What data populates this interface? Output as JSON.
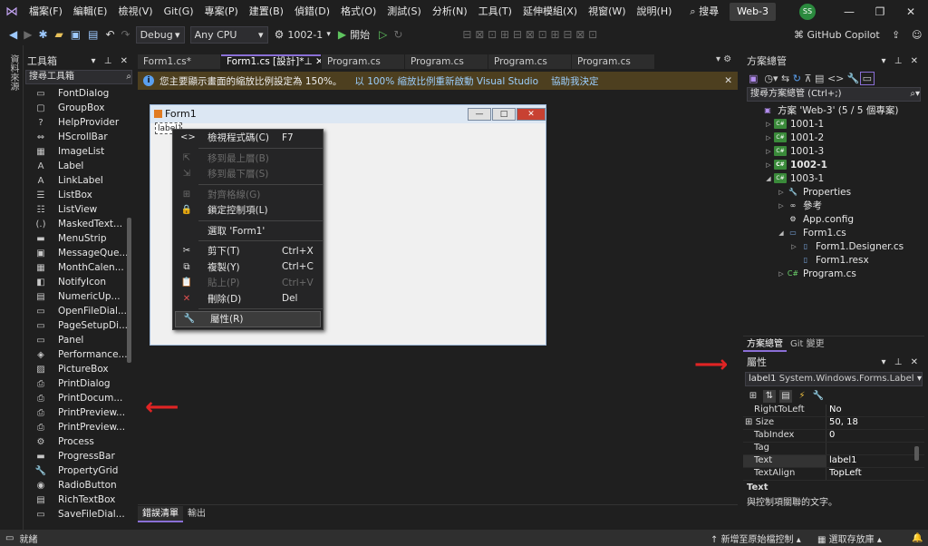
{
  "menubar": {
    "items": [
      "檔案(F)",
      "編輯(E)",
      "檢視(V)",
      "Git(G)",
      "專案(P)",
      "建置(B)",
      "偵錯(D)",
      "格式(O)",
      "測試(S)",
      "分析(N)",
      "工具(T)",
      "延伸模組(X)",
      "視窗(W)",
      "說明(H)"
    ],
    "search": "搜尋",
    "solution_name": "Web-3",
    "avatar": "SS"
  },
  "toolbar": {
    "config": "Debug",
    "platform": "Any CPU",
    "startup_project": "1002-1",
    "start_label": "開始",
    "copilot": "GitHub Copilot"
  },
  "left_strip": {
    "label": "資料來源"
  },
  "toolbox": {
    "title": "工具箱",
    "search_placeholder": "搜尋工具箱",
    "items": [
      {
        "icon": "▭",
        "label": "FontDialog"
      },
      {
        "icon": "▢",
        "label": "GroupBox"
      },
      {
        "icon": "?",
        "label": "HelpProvider"
      },
      {
        "icon": "⇔",
        "label": "HScrollBar"
      },
      {
        "icon": "▦",
        "label": "ImageList"
      },
      {
        "icon": "A",
        "label": "Label"
      },
      {
        "icon": "A",
        "label": "LinkLabel"
      },
      {
        "icon": "☰",
        "label": "ListBox"
      },
      {
        "icon": "☷",
        "label": "ListView"
      },
      {
        "icon": "(.)",
        "label": "MaskedText..."
      },
      {
        "icon": "▬",
        "label": "MenuStrip"
      },
      {
        "icon": "▣",
        "label": "MessageQue..."
      },
      {
        "icon": "▦",
        "label": "MonthCalen..."
      },
      {
        "icon": "◧",
        "label": "NotifyIcon"
      },
      {
        "icon": "▤",
        "label": "NumericUp..."
      },
      {
        "icon": "▭",
        "label": "OpenFileDial..."
      },
      {
        "icon": "▭",
        "label": "PageSetupDi..."
      },
      {
        "icon": "▭",
        "label": "Panel"
      },
      {
        "icon": "◈",
        "label": "Performance..."
      },
      {
        "icon": "▨",
        "label": "PictureBox"
      },
      {
        "icon": "⎙",
        "label": "PrintDialog"
      },
      {
        "icon": "⎙",
        "label": "PrintDocum..."
      },
      {
        "icon": "⎙",
        "label": "PrintPreview..."
      },
      {
        "icon": "⎙",
        "label": "PrintPreview..."
      },
      {
        "icon": "⚙",
        "label": "Process"
      },
      {
        "icon": "▬",
        "label": "ProgressBar"
      },
      {
        "icon": "🔧",
        "label": "PropertyGrid"
      },
      {
        "icon": "◉",
        "label": "RadioButton"
      },
      {
        "icon": "▤",
        "label": "RichTextBox"
      },
      {
        "icon": "▭",
        "label": "SaveFileDial..."
      }
    ]
  },
  "tabs": [
    {
      "label": "Form1.cs*",
      "active": false
    },
    {
      "label": "Form1.cs [設計]*",
      "active": true
    },
    {
      "label": "Program.cs",
      "active": false
    },
    {
      "label": "Program.cs",
      "active": false
    },
    {
      "label": "Program.cs",
      "active": false
    },
    {
      "label": "Program.cs",
      "active": false
    }
  ],
  "infobar": {
    "message": "您主要顯示畫面的縮放比例設定為 150%。",
    "link1": "以 100% 縮放比例重新啟動 Visual Studio",
    "link2": "協助我決定"
  },
  "form": {
    "title": "Form1",
    "label": "label1"
  },
  "context_menu": [
    {
      "icon": "<>",
      "label": "檢視程式碼(C)",
      "shortcut": "F7",
      "disabled": false
    },
    {
      "sep": true
    },
    {
      "icon": "⇱",
      "label": "移到最上層(B)",
      "shortcut": "",
      "disabled": true
    },
    {
      "icon": "⇲",
      "label": "移到最下層(S)",
      "shortcut": "",
      "disabled": true
    },
    {
      "sep": true
    },
    {
      "icon": "⊞",
      "label": "對齊格線(G)",
      "shortcut": "",
      "disabled": true
    },
    {
      "icon": "🔒",
      "label": "鎖定控制項(L)",
      "shortcut": "",
      "disabled": false
    },
    {
      "sep": true
    },
    {
      "icon": "",
      "label": "選取 'Form1'",
      "shortcut": "",
      "disabled": false
    },
    {
      "sep": true
    },
    {
      "icon": "✂",
      "label": "剪下(T)",
      "shortcut": "Ctrl+X",
      "disabled": false
    },
    {
      "icon": "⧉",
      "label": "複製(Y)",
      "shortcut": "Ctrl+C",
      "disabled": false
    },
    {
      "icon": "📋",
      "label": "貼上(P)",
      "shortcut": "Ctrl+V",
      "disabled": true
    },
    {
      "icon": "✕",
      "label": "刪除(D)",
      "shortcut": "Del",
      "disabled": false
    },
    {
      "sep": true
    },
    {
      "icon": "🔧",
      "label": "屬性(R)",
      "shortcut": "",
      "disabled": false,
      "selected": true
    }
  ],
  "bottom_tabs": [
    "錯誤清單",
    "輸出"
  ],
  "solution_explorer": {
    "title": "方案總管",
    "search_placeholder": "搜尋方案總管 (Ctrl+;)",
    "nodes": [
      {
        "depth": 0,
        "arrow": "",
        "icon": "sln",
        "label": "方案 'Web-3' (5 / 5 個專案)",
        "bold": false
      },
      {
        "depth": 1,
        "arrow": "▷",
        "icon": "cs",
        "label": "1001-1",
        "bold": false
      },
      {
        "depth": 1,
        "arrow": "▷",
        "icon": "cs",
        "label": "1001-2",
        "bold": false
      },
      {
        "depth": 1,
        "arrow": "▷",
        "icon": "cs",
        "label": "1001-3",
        "bold": false
      },
      {
        "depth": 1,
        "arrow": "▷",
        "icon": "cs",
        "label": "1002-1",
        "bold": true
      },
      {
        "depth": 1,
        "arrow": "◢",
        "icon": "cs",
        "label": "1003-1",
        "bold": false
      },
      {
        "depth": 2,
        "arrow": "▷",
        "icon": "wrench",
        "label": "Properties",
        "bold": false
      },
      {
        "depth": 2,
        "arrow": "▷",
        "icon": "ref",
        "label": "參考",
        "bold": false
      },
      {
        "depth": 2,
        "arrow": "",
        "icon": "config",
        "label": "App.config",
        "bold": false
      },
      {
        "depth": 2,
        "arrow": "◢",
        "icon": "form",
        "label": "Form1.cs",
        "bold": false
      },
      {
        "depth": 3,
        "arrow": "▷",
        "icon": "file",
        "label": "Form1.Designer.cs",
        "bold": false
      },
      {
        "depth": 3,
        "arrow": "",
        "icon": "file",
        "label": "Form1.resx",
        "bold": false
      },
      {
        "depth": 2,
        "arrow": "▷",
        "icon": "csfile",
        "label": "Program.cs",
        "bold": false
      }
    ],
    "footer_tabs": [
      "方案總管",
      "Git 變更"
    ]
  },
  "properties": {
    "title": "屬性",
    "object_name": "label1",
    "object_type": "System.Windows.Forms.Label",
    "rows": [
      {
        "name": "RightToLeft",
        "value": "No",
        "expand": false
      },
      {
        "name": "Size",
        "value": "50, 18",
        "expand": true
      },
      {
        "name": "TabIndex",
        "value": "0",
        "expand": false
      },
      {
        "name": "Tag",
        "value": "",
        "expand": false
      },
      {
        "name": "Text",
        "value": "label1",
        "expand": false,
        "selected": true
      },
      {
        "name": "TextAlign",
        "value": "TopLeft",
        "expand": false
      }
    ],
    "desc_title": "Text",
    "desc_text": "與控制項關聯的文字。"
  },
  "statusbar": {
    "ready": "就緒",
    "add_source": "新增至原始檔控制",
    "select_repo": "選取存放庫"
  },
  "colors": {
    "accent": "#8a6fd6",
    "arrow": "#e02424",
    "infobar": "#4d3f1f"
  }
}
